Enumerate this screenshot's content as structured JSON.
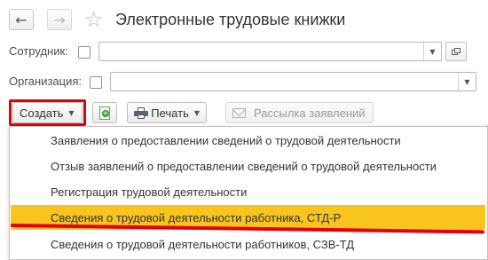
{
  "header": {
    "back_glyph": "←",
    "forward_glyph": "→",
    "star_glyph": "☆",
    "title": "Электронные трудовые книжки"
  },
  "filters": {
    "employee_label": "Сотрудник:",
    "employee_value": "",
    "organization_label": "Организация:",
    "organization_value": "",
    "dropdown_glyph": "▼"
  },
  "toolbar": {
    "create_label": "Создать",
    "print_label": "Печать",
    "mailing_label": "Рассылка заявлений",
    "caret_glyph": "▼",
    "add_glyph": "+"
  },
  "create_menu": {
    "items": [
      {
        "label": "Заявления о предоставлении сведений о трудовой деятельности",
        "selected": false
      },
      {
        "label": "Отзыв заявлений о предоставлении сведений о трудовой деятельности",
        "selected": false
      },
      {
        "label": "Регистрация трудовой деятельности",
        "selected": false
      },
      {
        "label": "Сведения о трудовой деятельности работника, СТД-Р",
        "selected": true
      },
      {
        "label": "Сведения о трудовой деятельности работников, СЗВ-ТД",
        "selected": false
      }
    ]
  },
  "colors": {
    "highlight_box": "#e3000b",
    "underline": "#e3000b",
    "selected_item": "#fac41e"
  }
}
